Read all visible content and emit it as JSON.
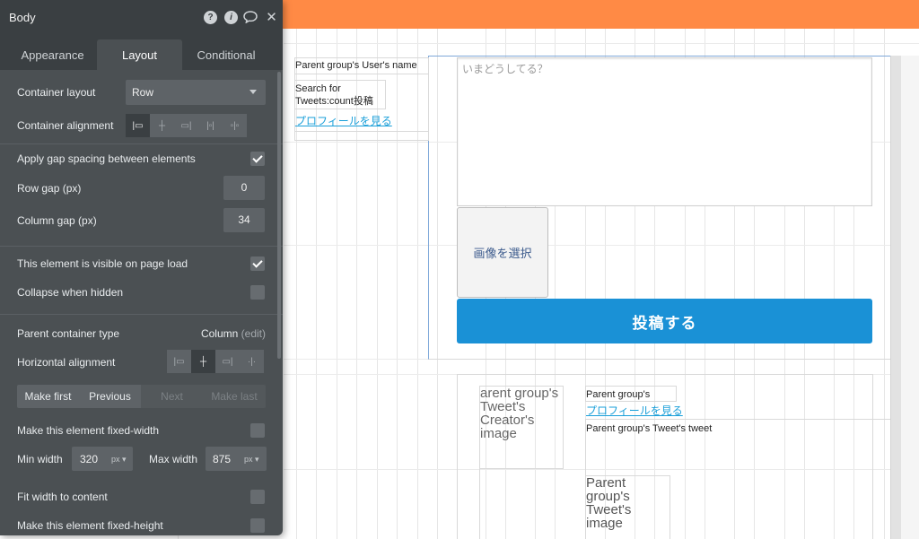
{
  "panel": {
    "title": "Body",
    "tabs": [
      "Appearance",
      "Layout",
      "Conditional"
    ],
    "container_layout": {
      "label": "Container layout",
      "value": "Row"
    },
    "container_alignment": {
      "label": "Container alignment"
    },
    "gap_spacing": {
      "label": "Apply gap spacing between elements",
      "checked": true
    },
    "row_gap": {
      "label": "Row gap (px)",
      "value": "0"
    },
    "column_gap": {
      "label": "Column gap (px)",
      "value": "34"
    },
    "visible_on_load": {
      "label": "This element is visible on page load",
      "checked": true
    },
    "collapse_hidden": {
      "label": "Collapse when hidden",
      "checked": false
    },
    "parent_container": {
      "label": "Parent container type",
      "value": "Column",
      "edit": "(edit)"
    },
    "horizontal_alignment": {
      "label": "Horizontal alignment"
    },
    "nav": {
      "make_first": "Make first",
      "previous": "Previous",
      "next": "Next",
      "make_last": "Make last"
    },
    "fixed_width": {
      "label": "Make this element fixed-width",
      "checked": false
    },
    "min_width": {
      "label": "Min width",
      "value": "320",
      "unit": "px"
    },
    "max_width": {
      "label": "Max width",
      "value": "875",
      "unit": "px"
    },
    "fit_width": {
      "label": "Fit width to content",
      "checked": false
    },
    "fixed_height": {
      "label": "Make this element fixed-height",
      "checked": false
    }
  },
  "canvas": {
    "user_name": "Parent group's User's name",
    "search_line1": "Search for",
    "search_line2": "Tweets:count投稿",
    "profile_link": "プロフィールを見る",
    "tweet_placeholder": "いまどうしてる？",
    "select_image": "画像を選択",
    "post_button": "投稿する",
    "creator_image_text": "arent group's Tweet's Creator's image",
    "parent_group": "Parent group's",
    "profile_link2": "プロフィールを見る",
    "tweet_text": "Parent group's Tweet's tweet",
    "tweet_image_text": "Parent group's Tweet's image"
  },
  "colors": {
    "top_bar": "#ff8a45",
    "post_button": "#1a91d6",
    "panel_bg": "#4b5053",
    "link": "#1a9fd9"
  }
}
